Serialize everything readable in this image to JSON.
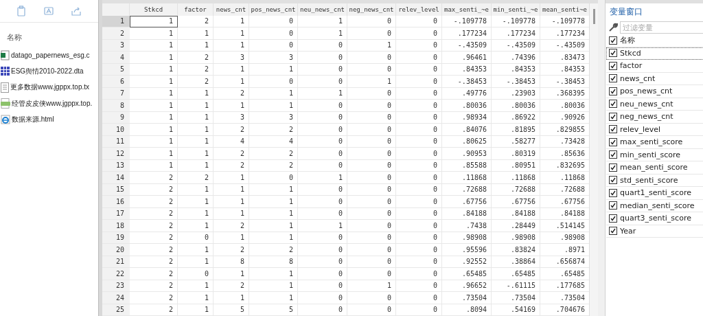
{
  "explorer": {
    "toolbar": [
      {
        "kind": "copy"
      },
      {
        "kind": "rename"
      },
      {
        "kind": "share"
      }
    ],
    "column_header": "名称",
    "files": [
      {
        "kind": "csv",
        "name": "datago_papernews_esg.c"
      },
      {
        "kind": "dta",
        "name": "ESG舆情2010-2022.dta"
      },
      {
        "kind": "txt",
        "name": "更多数据www.jgppx.top.tx"
      },
      {
        "kind": "png",
        "name": "经管皮皮侠www.jgppx.top."
      },
      {
        "kind": "html",
        "name": "数据来源.html"
      }
    ]
  },
  "table": {
    "columns": [
      "Stkcd",
      "factor",
      "news_cnt",
      "pos_news_cnt",
      "neu_news_cnt",
      "neg_news_cnt",
      "relev_level",
      "max_senti_~e",
      "min_senti_~e",
      "mean_senti~e"
    ],
    "rows": [
      {
        "n": "1",
        "selected": true,
        "cells": [
          "1",
          "2",
          "1",
          "0",
          "1",
          "0",
          "0",
          "-.109778",
          "-.109778",
          "-.109778"
        ]
      },
      {
        "n": "2",
        "selected": false,
        "cells": [
          "1",
          "1",
          "1",
          "0",
          "1",
          "0",
          "0",
          ".177234",
          ".177234",
          ".177234"
        ]
      },
      {
        "n": "3",
        "selected": false,
        "cells": [
          "1",
          "1",
          "1",
          "0",
          "0",
          "1",
          "0",
          "-.43509",
          "-.43509",
          "-.43509"
        ]
      },
      {
        "n": "4",
        "selected": false,
        "cells": [
          "1",
          "2",
          "3",
          "3",
          "0",
          "0",
          "0",
          ".96461",
          ".74396",
          ".83473"
        ]
      },
      {
        "n": "5",
        "selected": false,
        "cells": [
          "1",
          "2",
          "1",
          "1",
          "0",
          "0",
          "0",
          ".84353",
          ".84353",
          ".84353"
        ]
      },
      {
        "n": "6",
        "selected": false,
        "cells": [
          "1",
          "2",
          "1",
          "0",
          "0",
          "1",
          "0",
          "-.38453",
          "-.38453",
          "-.38453"
        ]
      },
      {
        "n": "7",
        "selected": false,
        "cells": [
          "1",
          "1",
          "2",
          "1",
          "1",
          "0",
          "0",
          ".49776",
          ".23903",
          ".368395"
        ]
      },
      {
        "n": "8",
        "selected": false,
        "cells": [
          "1",
          "1",
          "1",
          "1",
          "0",
          "0",
          "0",
          ".80036",
          ".80036",
          ".80036"
        ]
      },
      {
        "n": "9",
        "selected": false,
        "cells": [
          "1",
          "1",
          "3",
          "3",
          "0",
          "0",
          "0",
          ".98934",
          ".86922",
          ".90926"
        ]
      },
      {
        "n": "10",
        "selected": false,
        "cells": [
          "1",
          "1",
          "2",
          "2",
          "0",
          "0",
          "0",
          ".84076",
          ".81895",
          ".829855"
        ]
      },
      {
        "n": "11",
        "selected": false,
        "cells": [
          "1",
          "1",
          "4",
          "4",
          "0",
          "0",
          "0",
          ".80625",
          ".58277",
          ".73428"
        ]
      },
      {
        "n": "12",
        "selected": false,
        "cells": [
          "1",
          "1",
          "2",
          "2",
          "0",
          "0",
          "0",
          ".90953",
          ".80319",
          ".85636"
        ]
      },
      {
        "n": "13",
        "selected": false,
        "cells": [
          "1",
          "1",
          "2",
          "2",
          "0",
          "0",
          "0",
          ".85588",
          ".80951",
          ".832695"
        ]
      },
      {
        "n": "14",
        "selected": false,
        "cells": [
          "2",
          "2",
          "1",
          "0",
          "1",
          "0",
          "0",
          ".11868",
          ".11868",
          ".11868"
        ]
      },
      {
        "n": "15",
        "selected": false,
        "cells": [
          "2",
          "1",
          "1",
          "1",
          "0",
          "0",
          "0",
          ".72688",
          ".72688",
          ".72688"
        ]
      },
      {
        "n": "16",
        "selected": false,
        "cells": [
          "2",
          "1",
          "1",
          "1",
          "0",
          "0",
          "0",
          ".67756",
          ".67756",
          ".67756"
        ]
      },
      {
        "n": "17",
        "selected": false,
        "cells": [
          "2",
          "1",
          "1",
          "1",
          "0",
          "0",
          "0",
          ".84188",
          ".84188",
          ".84188"
        ]
      },
      {
        "n": "18",
        "selected": false,
        "cells": [
          "2",
          "1",
          "2",
          "1",
          "1",
          "0",
          "0",
          ".7438",
          ".28449",
          ".514145"
        ]
      },
      {
        "n": "19",
        "selected": false,
        "cells": [
          "2",
          "0",
          "1",
          "1",
          "0",
          "0",
          "0",
          ".98908",
          ".98908",
          ".98908"
        ]
      },
      {
        "n": "20",
        "selected": false,
        "cells": [
          "2",
          "1",
          "2",
          "2",
          "0",
          "0",
          "0",
          ".95596",
          ".83824",
          ".8971"
        ]
      },
      {
        "n": "21",
        "selected": false,
        "cells": [
          "2",
          "1",
          "8",
          "8",
          "0",
          "0",
          "0",
          ".92552",
          ".38864",
          ".656874"
        ]
      },
      {
        "n": "22",
        "selected": false,
        "cells": [
          "2",
          "0",
          "1",
          "1",
          "0",
          "0",
          "0",
          ".65485",
          ".65485",
          ".65485"
        ]
      },
      {
        "n": "23",
        "selected": false,
        "cells": [
          "2",
          "1",
          "2",
          "1",
          "0",
          "1",
          "0",
          ".96652",
          "-.61115",
          ".177685"
        ]
      },
      {
        "n": "24",
        "selected": false,
        "cells": [
          "2",
          "1",
          "1",
          "1",
          "0",
          "0",
          "0",
          ".73504",
          ".73504",
          ".73504"
        ]
      },
      {
        "n": "25",
        "selected": false,
        "cells": [
          "2",
          "1",
          "5",
          "5",
          "0",
          "0",
          "0",
          ".8094",
          ".54169",
          ".704676"
        ]
      }
    ]
  },
  "variables": {
    "title": "变量窗口",
    "filter_placeholder": "过滤变量",
    "header": {
      "label": "名称",
      "checked": true
    },
    "items": [
      {
        "name": "Stkcd",
        "checked": true,
        "focused": true
      },
      {
        "name": "factor",
        "checked": true,
        "focused": false
      },
      {
        "name": "news_cnt",
        "checked": true,
        "focused": false
      },
      {
        "name": "pos_news_cnt",
        "checked": true,
        "focused": false
      },
      {
        "name": "neu_news_cnt",
        "checked": true,
        "focused": false
      },
      {
        "name": "neg_news_cnt",
        "checked": true,
        "focused": false
      },
      {
        "name": "relev_level",
        "checked": true,
        "focused": false
      },
      {
        "name": "max_senti_score",
        "checked": true,
        "focused": false
      },
      {
        "name": "min_senti_score",
        "checked": true,
        "focused": false
      },
      {
        "name": "mean_senti_score",
        "checked": true,
        "focused": false
      },
      {
        "name": "std_senti_score",
        "checked": true,
        "focused": false
      },
      {
        "name": "quart1_senti_score",
        "checked": true,
        "focused": false
      },
      {
        "name": "median_senti_score",
        "checked": true,
        "focused": false
      },
      {
        "name": "quart3_senti_score",
        "checked": true,
        "focused": false
      },
      {
        "name": "Year",
        "checked": true,
        "focused": false
      }
    ]
  }
}
